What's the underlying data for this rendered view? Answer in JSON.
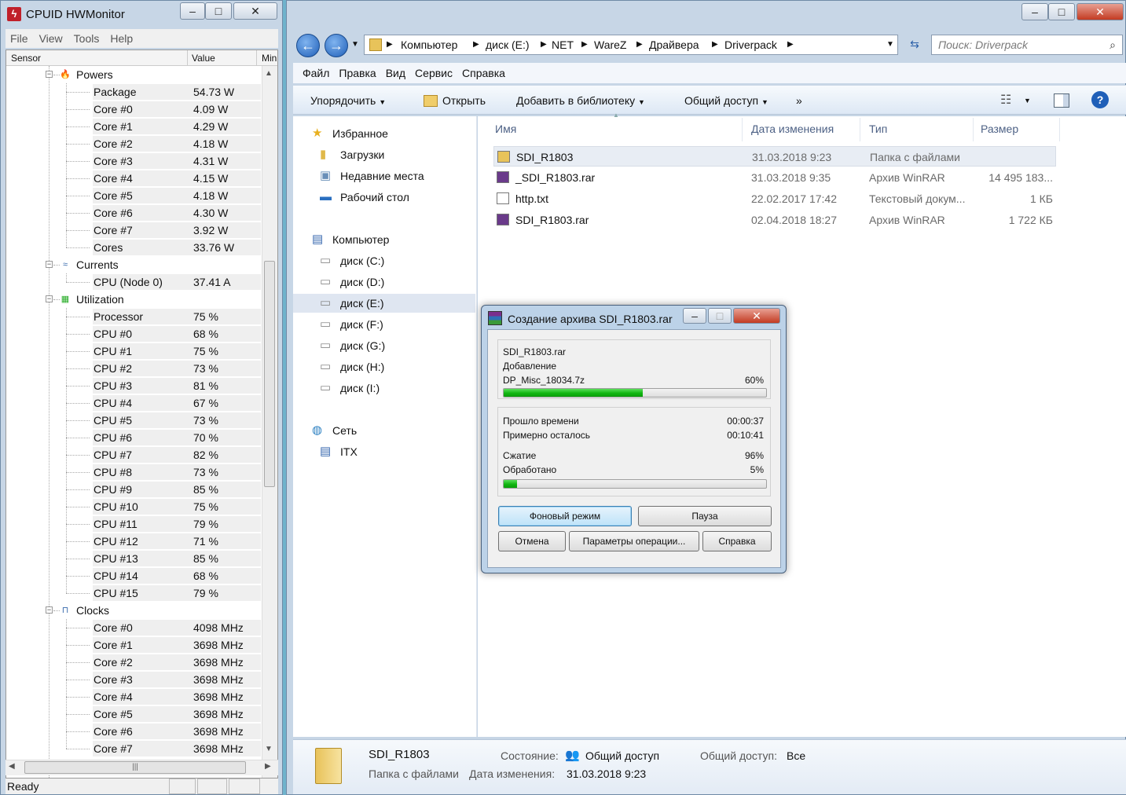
{
  "hwmonitor": {
    "title": "CPUID HWMonitor",
    "menu": [
      "File",
      "View",
      "Tools",
      "Help"
    ],
    "columns": {
      "sensor": "Sensor",
      "value": "Value",
      "min": "Min"
    },
    "status": "Ready",
    "groups": [
      {
        "name": "Powers",
        "icon": "power-icon",
        "items": [
          {
            "label": "Package",
            "value": "54.73 W"
          },
          {
            "label": "Core #0",
            "value": "4.09 W"
          },
          {
            "label": "Core #1",
            "value": "4.29 W"
          },
          {
            "label": "Core #2",
            "value": "4.18 W"
          },
          {
            "label": "Core #3",
            "value": "4.31 W"
          },
          {
            "label": "Core #4",
            "value": "4.15 W"
          },
          {
            "label": "Core #5",
            "value": "4.18 W"
          },
          {
            "label": "Core #6",
            "value": "4.30 W"
          },
          {
            "label": "Core #7",
            "value": "3.92 W"
          },
          {
            "label": "Cores",
            "value": "33.76 W"
          }
        ]
      },
      {
        "name": "Currents",
        "icon": "current-icon",
        "items": [
          {
            "label": "CPU (Node 0)",
            "value": "37.41 A"
          }
        ]
      },
      {
        "name": "Utilization",
        "icon": "utilization-icon",
        "items": [
          {
            "label": "Processor",
            "value": "75 %"
          },
          {
            "label": "CPU #0",
            "value": "68 %"
          },
          {
            "label": "CPU #1",
            "value": "75 %"
          },
          {
            "label": "CPU #2",
            "value": "73 %"
          },
          {
            "label": "CPU #3",
            "value": "81 %"
          },
          {
            "label": "CPU #4",
            "value": "67 %"
          },
          {
            "label": "CPU #5",
            "value": "73 %"
          },
          {
            "label": "CPU #6",
            "value": "70 %"
          },
          {
            "label": "CPU #7",
            "value": "82 %"
          },
          {
            "label": "CPU #8",
            "value": "73 %"
          },
          {
            "label": "CPU #9",
            "value": "85 %"
          },
          {
            "label": "CPU #10",
            "value": "75 %"
          },
          {
            "label": "CPU #11",
            "value": "79 %"
          },
          {
            "label": "CPU #12",
            "value": "71 %"
          },
          {
            "label": "CPU #13",
            "value": "85 %"
          },
          {
            "label": "CPU #14",
            "value": "68 %"
          },
          {
            "label": "CPU #15",
            "value": "79 %"
          }
        ]
      },
      {
        "name": "Clocks",
        "icon": "clock-icon",
        "items": [
          {
            "label": "Core #0",
            "value": "4098 MHz"
          },
          {
            "label": "Core #1",
            "value": "3698 MHz"
          },
          {
            "label": "Core #2",
            "value": "3698 MHz"
          },
          {
            "label": "Core #3",
            "value": "3698 MHz"
          },
          {
            "label": "Core #4",
            "value": "3698 MHz"
          },
          {
            "label": "Core #5",
            "value": "3698 MHz"
          },
          {
            "label": "Core #6",
            "value": "3698 MHz"
          },
          {
            "label": "Core #7",
            "value": "3698 MHz"
          }
        ]
      }
    ]
  },
  "explorer": {
    "breadcrumb": [
      "Компьютер",
      "диск (E:)",
      "NET",
      "WareZ",
      "Драйвера",
      "Driverpack"
    ],
    "search_placeholder": "Поиск: Driverpack",
    "menu": [
      "Файл",
      "Правка",
      "Вид",
      "Сервис",
      "Справка"
    ],
    "commands": {
      "organize": "Упорядочить",
      "open": "Открыть",
      "library": "Добавить в библиотеку",
      "share": "Общий доступ",
      "more": "»"
    },
    "nav": [
      {
        "label": "Избранное",
        "icon": "star-icon",
        "level": 0
      },
      {
        "label": "Загрузки",
        "icon": "downloads-folder-icon",
        "level": 1
      },
      {
        "label": "Недавние места",
        "icon": "recent-places-icon",
        "level": 1
      },
      {
        "label": "Рабочий стол",
        "icon": "desktop-icon",
        "level": 1
      },
      {
        "label": "Компьютер",
        "icon": "computer-icon",
        "level": 0
      },
      {
        "label": "диск (C:)",
        "icon": "drive-icon",
        "level": 1
      },
      {
        "label": "диск (D:)",
        "icon": "drive-icon",
        "level": 1
      },
      {
        "label": "диск (E:)",
        "icon": "drive-icon",
        "level": 1,
        "selected": true
      },
      {
        "label": "диск (F:)",
        "icon": "drive-icon",
        "level": 1
      },
      {
        "label": "диск (G:)",
        "icon": "drive-icon",
        "level": 1
      },
      {
        "label": "диск (H:)",
        "icon": "drive-icon",
        "level": 1
      },
      {
        "label": "диск (I:)",
        "icon": "drive-icon",
        "level": 1
      },
      {
        "label": "Сеть",
        "icon": "network-icon",
        "level": 0
      },
      {
        "label": "ITX",
        "icon": "network-computer-icon",
        "level": 1
      }
    ],
    "columns": {
      "name": "Имя",
      "date": "Дата изменения",
      "type": "Тип",
      "size": "Размер"
    },
    "files": [
      {
        "name": "SDI_R1803",
        "date": "31.03.2018 9:23",
        "type": "Папка с файлами",
        "size": "",
        "icon": "folder-icon",
        "selected": true
      },
      {
        "name": "_SDI_R1803.rar",
        "date": "31.03.2018 9:35",
        "type": "Архив WinRAR",
        "size": "14 495 183...",
        "icon": "winrar-archive-icon"
      },
      {
        "name": "http.txt",
        "date": "22.02.2017 17:42",
        "type": "Текстовый докум...",
        "size": "1 КБ",
        "icon": "text-file-icon"
      },
      {
        "name": "SDI_R1803.rar",
        "date": "02.04.2018 18:27",
        "type": "Архив WinRAR",
        "size": "1 722 КБ",
        "icon": "winrar-archive-icon"
      }
    ],
    "details": {
      "name": "SDI_R1803",
      "type": "Папка с файлами",
      "state_label": "Состояние:",
      "state_value": "Общий доступ",
      "shared_label": "Общий доступ:",
      "shared_value": "Все",
      "date_label": "Дата изменения:",
      "date_value": "31.03.2018 9:23"
    }
  },
  "rar": {
    "title": "Создание архива SDI_R1803.rar",
    "archive": "SDI_R1803.rar",
    "action": "Добавление",
    "current_file": "DP_Misc_18034.7z",
    "file_percent": "60%",
    "file_progress": 0.53,
    "elapsed_label": "Прошло времени",
    "elapsed_value": "00:00:37",
    "remaining_label": "Примерно осталось",
    "remaining_value": "00:10:41",
    "ratio_label": "Сжатие",
    "ratio_value": "96%",
    "processed_label": "Обработано",
    "processed_value": "5%",
    "total_progress": 0.05,
    "buttons": {
      "background": "Фоновый режим",
      "pause": "Пауза",
      "cancel": "Отмена",
      "params": "Параметры операции...",
      "help": "Справка"
    }
  }
}
